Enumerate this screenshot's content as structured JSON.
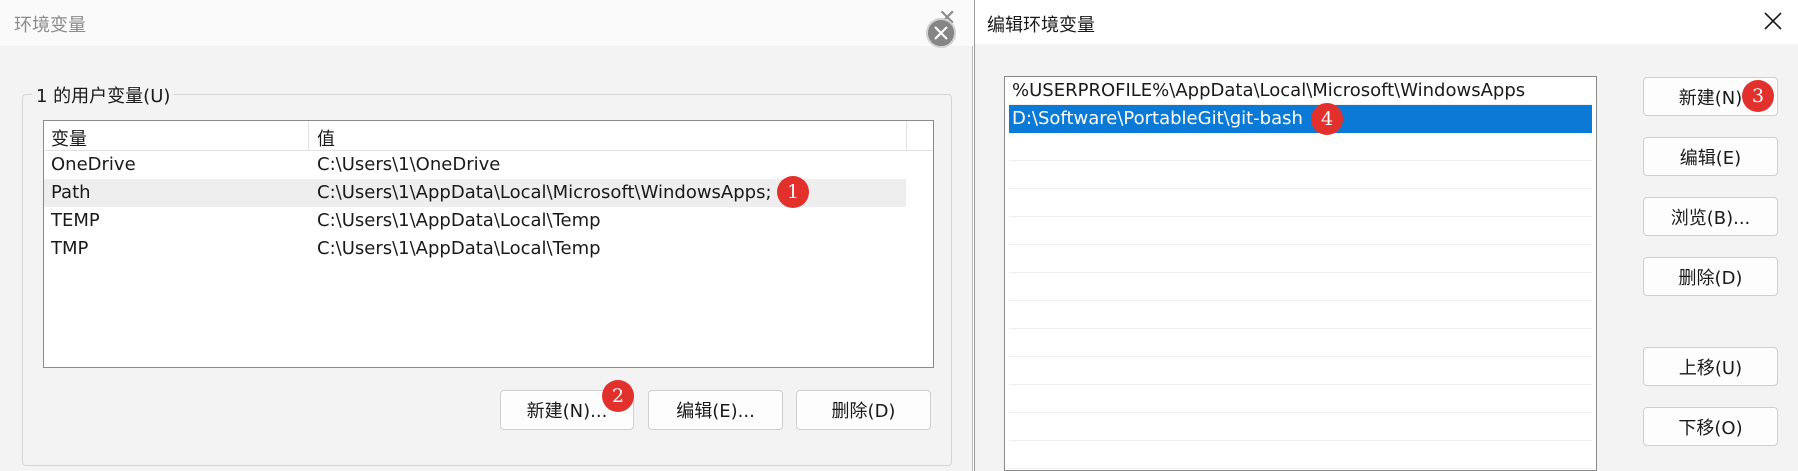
{
  "env_dialog": {
    "title": "环境变量",
    "user_vars_group": "1 的用户变量(U)",
    "columns": [
      "变量",
      "值"
    ],
    "rows": [
      {
        "name": "OneDrive",
        "value": "C:\\Users\\1\\OneDrive"
      },
      {
        "name": "Path",
        "value": "C:\\Users\\1\\AppData\\Local\\Microsoft\\WindowsApps;"
      },
      {
        "name": "TEMP",
        "value": "C:\\Users\\1\\AppData\\Local\\Temp"
      },
      {
        "name": "TMP",
        "value": "C:\\Users\\1\\AppData\\Local\\Temp"
      }
    ],
    "buttons": {
      "new": "新建(N)...",
      "edit": "编辑(E)...",
      "delete": "删除(D)"
    }
  },
  "edit_dialog": {
    "title": "编辑环境变量",
    "paths": [
      "%USERPROFILE%\\AppData\\Local\\Microsoft\\WindowsApps",
      "D:\\Software\\PortableGit\\git-bash"
    ],
    "selected_index": 1,
    "buttons": {
      "new": "新建(N)",
      "edit": "编辑(E)",
      "browse": "浏览(B)...",
      "delete": "删除(D)",
      "move_up": "上移(U)",
      "move_down": "下移(O)"
    }
  },
  "markers": [
    "1",
    "2",
    "3",
    "4"
  ],
  "colors": {
    "selection": "#0a7ad6",
    "marker": "#e2312c"
  }
}
